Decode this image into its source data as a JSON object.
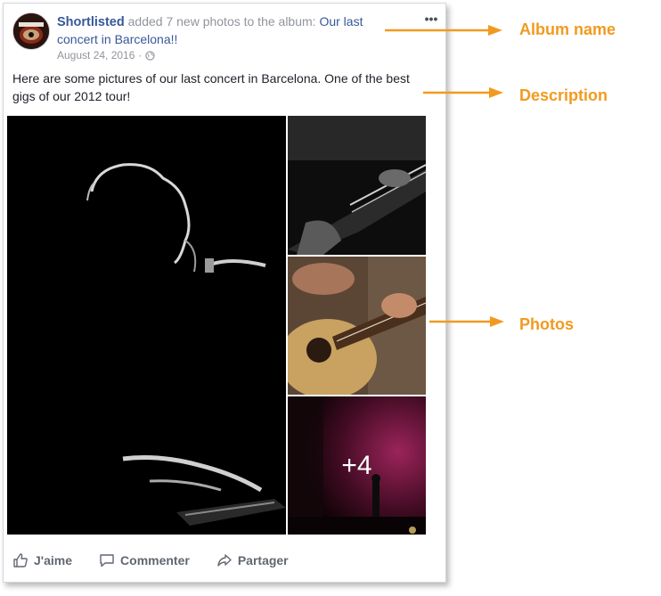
{
  "post": {
    "author": "Shortlisted",
    "action_text": " added 7 new photos to the album: ",
    "album_name": "Our last concert in Barcelona!!",
    "date": "August 24, 2016",
    "more_label": "•••",
    "description": "Here are some pictures of our last concert in Barcelona. One of the best gigs of our 2012 tour!",
    "more_photos": "+4"
  },
  "actions": {
    "like": "J'aime",
    "comment": "Commenter",
    "share": "Partager"
  },
  "annotations": {
    "album_name": "Album name",
    "description": "Description",
    "photos": "Photos"
  },
  "colors": {
    "link": "#365899",
    "annotation": "#f29a1f",
    "secondary_text": "#90949c"
  }
}
